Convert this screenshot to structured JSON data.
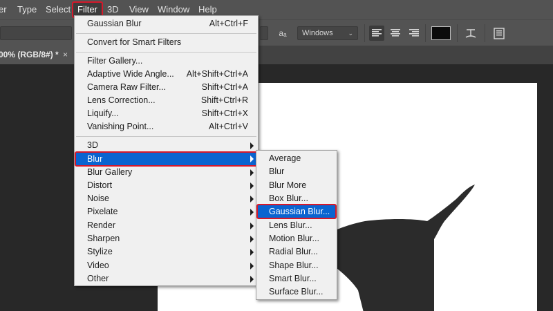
{
  "menubar": {
    "items": [
      "er",
      "Type",
      "Select",
      "Filter",
      "3D",
      "View",
      "Window",
      "Help"
    ],
    "active": "Filter"
  },
  "options": {
    "antialias_icon_text": "aₐ",
    "antialias_value": "Windows",
    "text_color": "#0c0c0c"
  },
  "document": {
    "tab_title": "00% (RGB/8#) *",
    "close_glyph": "×"
  },
  "filter_menu": {
    "items": [
      {
        "label": "Gaussian Blur",
        "shortcut": "Alt+Ctrl+F"
      },
      {
        "label": "Convert for Smart Filters",
        "shortcut": ""
      },
      {
        "label": "Filter Gallery...",
        "shortcut": ""
      },
      {
        "label": "Adaptive Wide Angle...",
        "shortcut": "Alt+Shift+Ctrl+A"
      },
      {
        "label": "Camera Raw Filter...",
        "shortcut": "Shift+Ctrl+A"
      },
      {
        "label": "Lens Correction...",
        "shortcut": "Shift+Ctrl+R"
      },
      {
        "label": "Liquify...",
        "shortcut": "Shift+Ctrl+X"
      },
      {
        "label": "Vanishing Point...",
        "shortcut": "Alt+Ctrl+V"
      },
      {
        "label": "3D",
        "submenu": true
      },
      {
        "label": "Blur",
        "submenu": true,
        "highlighted": true
      },
      {
        "label": "Blur Gallery",
        "submenu": true
      },
      {
        "label": "Distort",
        "submenu": true
      },
      {
        "label": "Noise",
        "submenu": true
      },
      {
        "label": "Pixelate",
        "submenu": true
      },
      {
        "label": "Render",
        "submenu": true
      },
      {
        "label": "Sharpen",
        "submenu": true
      },
      {
        "label": "Stylize",
        "submenu": true
      },
      {
        "label": "Video",
        "submenu": true
      },
      {
        "label": "Other",
        "submenu": true
      }
    ]
  },
  "blur_submenu": {
    "items": [
      {
        "label": "Average"
      },
      {
        "label": "Blur"
      },
      {
        "label": "Blur More"
      },
      {
        "label": "Box Blur..."
      },
      {
        "label": "Gaussian Blur...",
        "highlighted": true
      },
      {
        "label": "Lens Blur..."
      },
      {
        "label": "Motion Blur..."
      },
      {
        "label": "Radial Blur..."
      },
      {
        "label": "Shape Blur..."
      },
      {
        "label": "Smart Blur..."
      },
      {
        "label": "Surface Blur..."
      }
    ]
  },
  "colors": {
    "menu_highlight": "#0a64d0",
    "callout_outline": "#d7182a",
    "menu_bg": "#f0f0f0",
    "chrome_bg": "#535353",
    "workspace_bg": "#282828"
  }
}
